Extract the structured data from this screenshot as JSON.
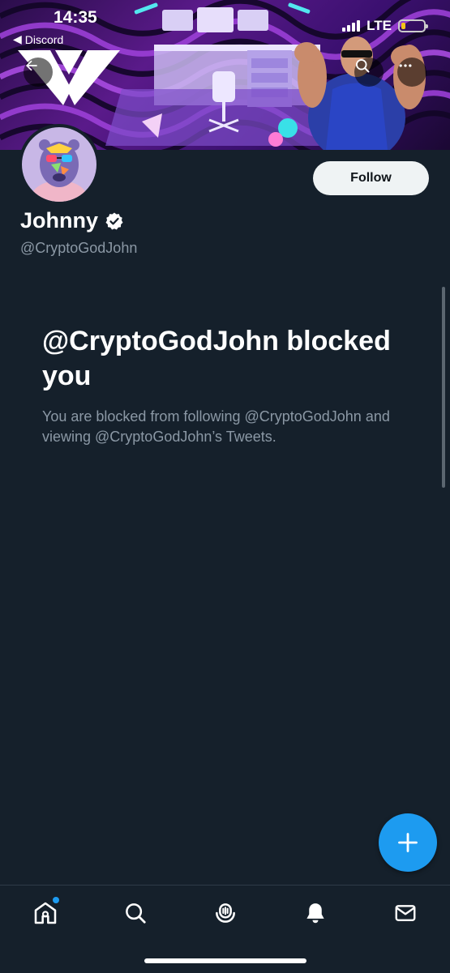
{
  "status_bar": {
    "time": "14:35",
    "back_app": "Discord",
    "network": "LTE",
    "signal_bars": 4,
    "battery_level": 0.2
  },
  "banner": {
    "back_icon": "arrow-left-icon",
    "search_icon": "search-icon",
    "more_icon": "more-horizontal-icon"
  },
  "profile": {
    "display_name": "Johnny",
    "handle": "@CryptoGodJohn",
    "verified": true,
    "follow_label": "Follow"
  },
  "blocked": {
    "title": "@CryptoGodJohn blocked you",
    "description": "You are blocked from following @CryptoGodJohn and viewing @CryptoGodJohn’s Tweets."
  },
  "fab": {
    "icon": "plus-icon"
  },
  "bottom_nav": {
    "items": [
      {
        "icon": "home-icon",
        "has_notification_dot": true
      },
      {
        "icon": "search-icon"
      },
      {
        "icon": "spaces-icon"
      },
      {
        "icon": "bell-icon"
      },
      {
        "icon": "mail-icon"
      }
    ]
  },
  "colors": {
    "background": "#15202b",
    "accent": "#1d9bf0",
    "secondary_text": "#8b98a5",
    "follow_button": "#eff3f4"
  }
}
